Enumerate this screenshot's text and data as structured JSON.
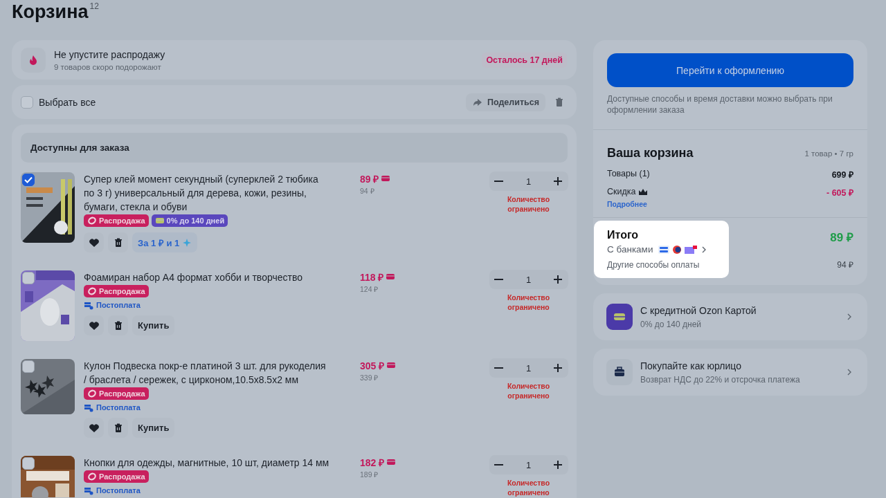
{
  "page": {
    "title": "Корзина",
    "count": "12"
  },
  "sale_banner": {
    "title": "Не упустите распродажу",
    "subtitle": "9 товаров скоро подорожают",
    "badge": "Осталось 17 дней"
  },
  "toolbar": {
    "select_all": {
      "label": "Выбрать все",
      "checked": false
    },
    "share_button": "Поделиться"
  },
  "section": {
    "title": "Доступны для заказа"
  },
  "items": [
    {
      "title": "Супер клей момент секундный (суперклей 2 тюбика по 3 г) универсальный для дерева, кожи, резины, бумаги, стекла и обуви",
      "checked": true,
      "tags": [
        {
          "kind": "sale",
          "label": "Распродажа"
        },
        {
          "kind": "installment",
          "label": "0% до 140 дней"
        }
      ],
      "action": {
        "kind": "bonus",
        "label": "За 1 ₽ и 1"
      },
      "price": "89 ₽",
      "old_price": "94 ₽",
      "quantity": "1",
      "limit_note": "Количество ограничено"
    },
    {
      "title": "Фоамиран набор А4 формат хобби и творчество",
      "checked": false,
      "tags": [
        {
          "kind": "sale",
          "label": "Распродажа"
        }
      ],
      "payment": "Постоплата",
      "action": {
        "kind": "buy",
        "label": "Купить"
      },
      "price": "118 ₽",
      "old_price": "124 ₽",
      "quantity": "1",
      "limit_note": "Количество ограничено"
    },
    {
      "title": "Кулон Подвеска покр-е платиной 3 шт. для рукоделия / браслета / сережек, с цирконом,10.5x8.5x2 мм",
      "checked": false,
      "tags": [
        {
          "kind": "sale",
          "label": "Распродажа"
        }
      ],
      "payment": "Постоплата",
      "action": {
        "kind": "buy",
        "label": "Купить"
      },
      "price": "305 ₽",
      "old_price": "339 ₽",
      "quantity": "1",
      "limit_note": "Количество ограничено"
    },
    {
      "title": "Кнопки для одежды, магнитные, 10 шт, диаметр 14 мм",
      "checked": false,
      "tags": [
        {
          "kind": "sale",
          "label": "Распродажа"
        }
      ],
      "payment": "Постоплата",
      "price": "182 ₽",
      "old_price": "189 ₽",
      "quantity": "1",
      "limit_note": "Количество ограничено"
    }
  ],
  "summary": {
    "checkout_button": "Перейти к оформлению",
    "delivery_note": "Доступные способы и время доставки можно выбрать при оформлении заказа",
    "cart_title": "Ваша корзина",
    "cart_meta": "1 товар • 7 гр",
    "rows": [
      {
        "kind": "plain",
        "label": "Товары (1)",
        "value": "699 ₽"
      },
      {
        "kind": "discount",
        "label": "Скидка",
        "value": "- 605 ₽",
        "link": "Подробнее"
      }
    ],
    "total": {
      "label": "Итого",
      "value": "89 ₽",
      "highlighted": true,
      "bank_label": "С банками",
      "other_label": "Другие способы оплаты",
      "other_value": "94 ₽"
    }
  },
  "offers": [
    {
      "kind": "card",
      "title": "С кредитной Ozon Картой",
      "subtitle": "0% до 140 дней"
    },
    {
      "kind": "business",
      "title": "Покупайте как юрлицо",
      "subtitle": "Возврат НДС до 22% и отсрочка платежа"
    }
  ]
}
